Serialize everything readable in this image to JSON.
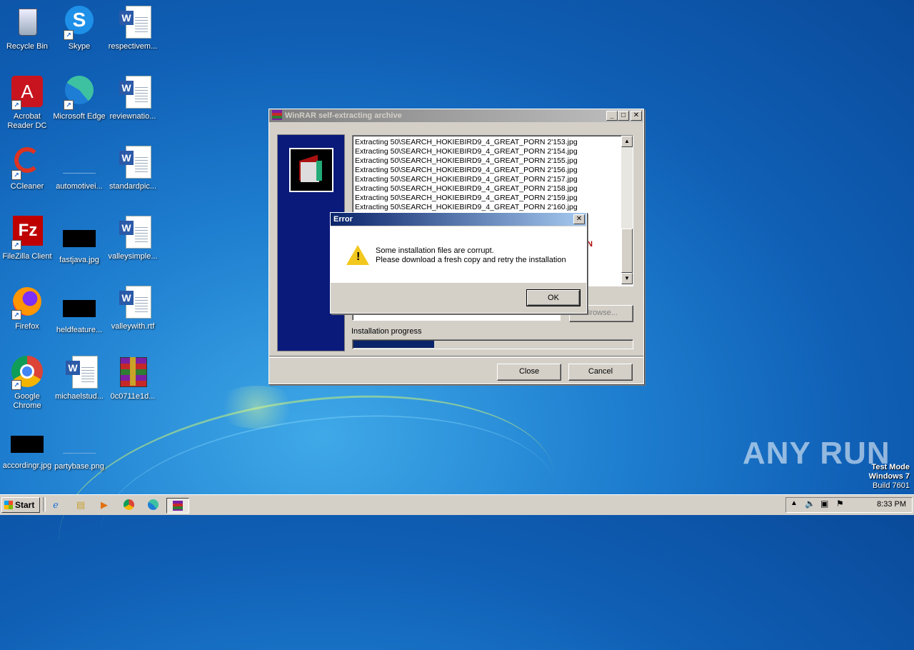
{
  "desktop": {
    "icons": [
      {
        "label": "Recycle Bin"
      },
      {
        "label": "Skype"
      },
      {
        "label": "respectivem..."
      },
      {
        "label": "Acrobat Reader DC"
      },
      {
        "label": "Microsoft Edge"
      },
      {
        "label": "reviewnatio..."
      },
      {
        "label": "CCleaner"
      },
      {
        "label": "automotivei..."
      },
      {
        "label": "standardpic..."
      },
      {
        "label": "FileZilla Client"
      },
      {
        "label": "fastjava.jpg"
      },
      {
        "label": "valleysimple..."
      },
      {
        "label": "Firefox"
      },
      {
        "label": "heldfeature..."
      },
      {
        "label": "valleywith.rtf"
      },
      {
        "label": "Google Chrome"
      },
      {
        "label": "michaelstud..."
      },
      {
        "label": "0c0711e1d..."
      },
      {
        "label": "accordingr.jpg"
      },
      {
        "label": "partybase.png"
      }
    ]
  },
  "winrar": {
    "title": "WinRAR self-extracting archive",
    "log_lines": [
      "Extracting 50\\SEARCH_HOKIEBIRD9_4_GREAT_PORN 2'153.jpg",
      "Extracting 50\\SEARCH_HOKIEBIRD9_4_GREAT_PORN 2'154.jpg",
      "Extracting 50\\SEARCH_HOKIEBIRD9_4_GREAT_PORN 2'155.jpg",
      "Extracting 50\\SEARCH_HOKIEBIRD9_4_GREAT_PORN 2'156.jpg",
      "Extracting 50\\SEARCH_HOKIEBIRD9_4_GREAT_PORN 2'157.jpg",
      "Extracting 50\\SEARCH_HOKIEBIRD9_4_GREAT_PORN 2'158.jpg",
      "Extracting 50\\SEARCH_HOKIEBIRD9_4_GREAT_PORN 2'159.jpg",
      "Extracting 50\\SEARCH_HOKIEBIRD9_4_GREAT_PORN 2'160.jpg"
    ],
    "log_fragment": "N",
    "browse_label": "Browse...",
    "progress_label": "Installation progress",
    "progress_fraction": 0.29,
    "close_label": "Close",
    "cancel_label": "Cancel"
  },
  "error_dialog": {
    "title": "Error",
    "message_line1": "Some installation files are corrupt.",
    "message_line2": "Please download a fresh copy and retry the installation",
    "ok_label": "OK"
  },
  "taskbar": {
    "start_label": "Start",
    "clock": "8:33 PM"
  },
  "watermark": {
    "brand": "ANY RUN",
    "mode_line": "Test Mode",
    "os_line": "Windows 7",
    "build_line": "Build 7601"
  },
  "colors": {
    "accent_title": "#0a246a",
    "progress_fill": "#0a246a"
  }
}
